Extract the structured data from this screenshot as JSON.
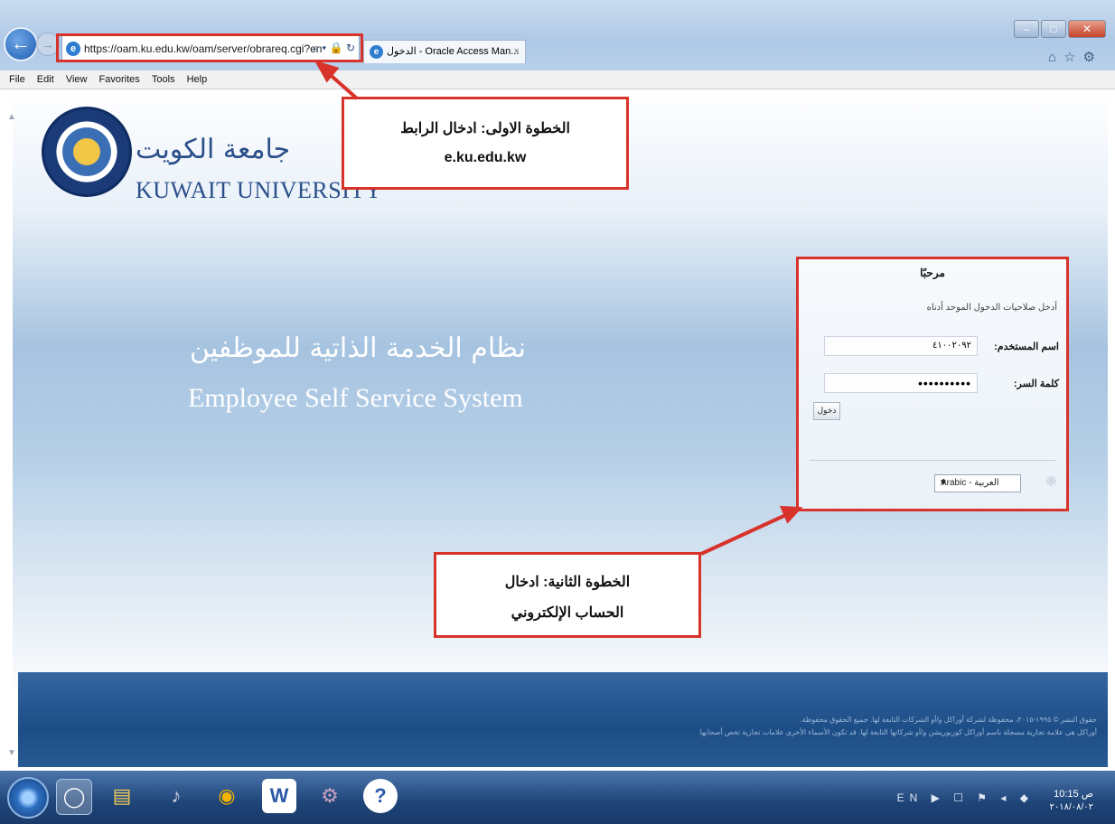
{
  "browser": {
    "url": "https://oam.ku.edu.kw/oam/server/obrareq.cgi?en",
    "address_tools": "⌕ ▾ 🔒 ↻",
    "tab_title": "الدخول - Oracle Access Man...",
    "tab_close": "×",
    "menu": [
      "File",
      "Edit",
      "View",
      "Favorites",
      "Tools",
      "Help"
    ],
    "window_controls": {
      "minimize": "–",
      "maximize": "□",
      "close": "✕"
    },
    "toolbar_icons": "⌂☆⚙"
  },
  "university": {
    "name_ar": "جامعة الكويت",
    "name_en": "KUWAIT UNIVERSITY"
  },
  "system": {
    "title_ar": "نظام الخدمة الذاتية للموظفين",
    "title_en": "Employee Self Service System"
  },
  "login": {
    "title": "مرحبًا",
    "intro": "أدخل صلاحيات الدخول الموحد أدناه",
    "username_label": "اسم المستخدم:",
    "username_value": "٤١٠٠٢٠٩٢",
    "password_label": "كلمة السر:",
    "password_value": "••••••••••",
    "login_button": "دخول",
    "language_selected": "Arabic - العربية"
  },
  "footer": {
    "line1": "حقوق النشر © ١٩٩٥-٢٠١٥، محفوظة لشركة أوراكل و/أو الشركات التابعة لها. جميع الحقوق محفوظة.",
    "line2": "أوراكل هي علامة تجارية مسجلة باسم أوراكل كوربوريشن و/أو شركاتها التابعة لها. قد تكون الأسماء الأخرى علامات تجارية تخص أصحابها."
  },
  "annotations": {
    "step1_line1": "الخطوة الاولى: ادخال الرابط",
    "step1_line2": "e.ku.edu.kw",
    "step2_line1": "الخطوة الثانية: ادخال",
    "step2_line2": "الحساب الإلكتروني",
    "highlight_color": "#d8332a"
  },
  "taskbar": {
    "language": "EN",
    "tray_icons": "▶ ☐ ⚑ ◂ ◆",
    "time": "10:15 ص",
    "date": "٢٠١٨/٠٨/٠٢",
    "icons": [
      "start-orb",
      "internet-explorer",
      "file-explorer",
      "media-player",
      "chrome",
      "word",
      "tool",
      "help"
    ]
  },
  "colors": {
    "accent_red": "#d8332a",
    "page_blue": "#a6c3e0",
    "footer_blue": "#1d4d86"
  }
}
